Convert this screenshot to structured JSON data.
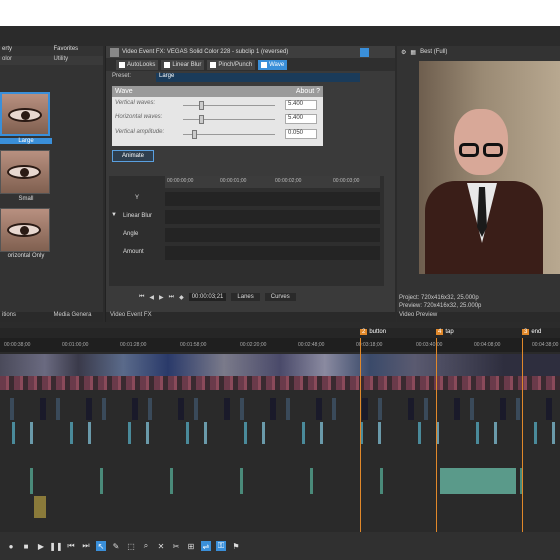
{
  "left_panel": {
    "tabs": [
      "erty",
      "Favorites"
    ],
    "subtabs": [
      "olor",
      "Utility"
    ],
    "presets": [
      {
        "label": "Large",
        "selected": true
      },
      {
        "label": "Small",
        "selected": false
      },
      {
        "label": "orizontal Only",
        "selected": false
      }
    ],
    "footer_tabs": [
      "itions",
      "Media Genera"
    ]
  },
  "fx_panel": {
    "title": "Video Event FX:  VEGAS Solid Color 228 - subclip 1 (reversed)",
    "chain": [
      "AutoLooks",
      "Linear Blur",
      "Pinch/Punch",
      "Wave"
    ],
    "preset_label": "Preset:",
    "preset_value": "Large",
    "wave": {
      "title": "Wave",
      "about": "About ?",
      "params": [
        {
          "label": "Vertical waves:",
          "value": "5.400",
          "level": 0.17
        },
        {
          "label": "Horizontal waves:",
          "value": "5.400",
          "level": 0.17
        },
        {
          "label": "Vertical amplitude:",
          "value": "0.050",
          "level": 0.1
        }
      ]
    },
    "animate_label": "Animate",
    "keyframe": {
      "ruler": [
        "00:00:00;00",
        "00:00:01;00",
        "00:00:02;00",
        "00:00:03;00"
      ],
      "rows": [
        "Y",
        "Linear Blur",
        "Angle",
        "Amount"
      ],
      "time": "00:00:03;21",
      "lanes_label": "Lanes",
      "curves_label": "Curves"
    },
    "footer_tab": "Video Event FX"
  },
  "preview": {
    "quality": "Best (Full)",
    "project": "Project:  720x416x32, 25.000p",
    "preview_info": "Preview:  720x416x32, 25.000p",
    "footer_tab": "Video Preview"
  },
  "timeline": {
    "markers": [
      {
        "num": "2",
        "label": "button"
      },
      {
        "num": "4",
        "label": "tap"
      },
      {
        "num": "3",
        "label": "end"
      }
    ],
    "ticks": [
      "00:00:38;00",
      "00:01:00;00",
      "00:01:28;00",
      "00:01:58;00",
      "00:02:20;00",
      "00:02:48;00",
      "00:03:18;00",
      "00:03:40;00",
      "00:04:08;00",
      "00:04:38;00"
    ]
  },
  "colors": {
    "accent": "#3a8fd9",
    "marker": "#e0882a"
  }
}
